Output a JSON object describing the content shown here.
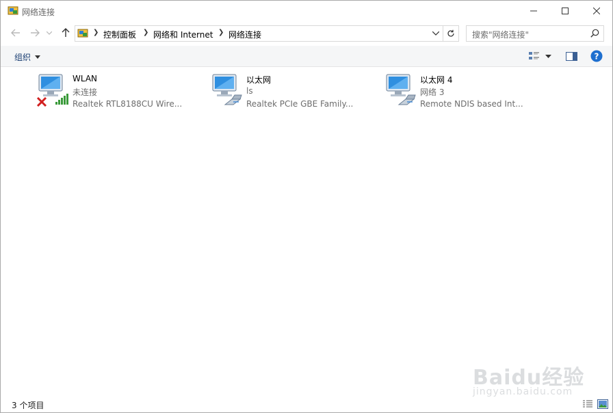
{
  "window": {
    "title": "网络连接"
  },
  "address": {
    "crumbs": [
      "控制面板",
      "网络和 Internet",
      "网络连接"
    ]
  },
  "search": {
    "placeholder": "搜索\"网络连接\""
  },
  "toolbar": {
    "organize_label": "组织"
  },
  "connections": [
    {
      "name": "WLAN",
      "status": "未连接",
      "device": "Realtek RTL8188CU Wire...",
      "type": "wireless",
      "disconnected": true
    },
    {
      "name": "以太网",
      "status": "ls",
      "device": "Realtek PCIe GBE Family...",
      "type": "ethernet",
      "disconnected": false
    },
    {
      "name": "以太网 4",
      "status": "网络 3",
      "device": "Remote NDIS based Int...",
      "type": "ethernet",
      "disconnected": false
    }
  ],
  "statusbar": {
    "item_count": "3 个项目"
  },
  "watermark": {
    "brand": "Baidu经验",
    "url": "jingyan.baidu.com"
  },
  "icons": {
    "title": "network-connections-icon",
    "back": "back-arrow-icon",
    "forward": "forward-arrow-icon",
    "recent": "chevron-down-icon",
    "up": "up-arrow-icon",
    "refresh": "refresh-icon",
    "search": "search-icon",
    "help": "help-icon"
  },
  "colors": {
    "accent": "#1a3e72",
    "help": "#1e6fcf",
    "error": "#d11f1f",
    "signal": "#3a9a3a"
  }
}
